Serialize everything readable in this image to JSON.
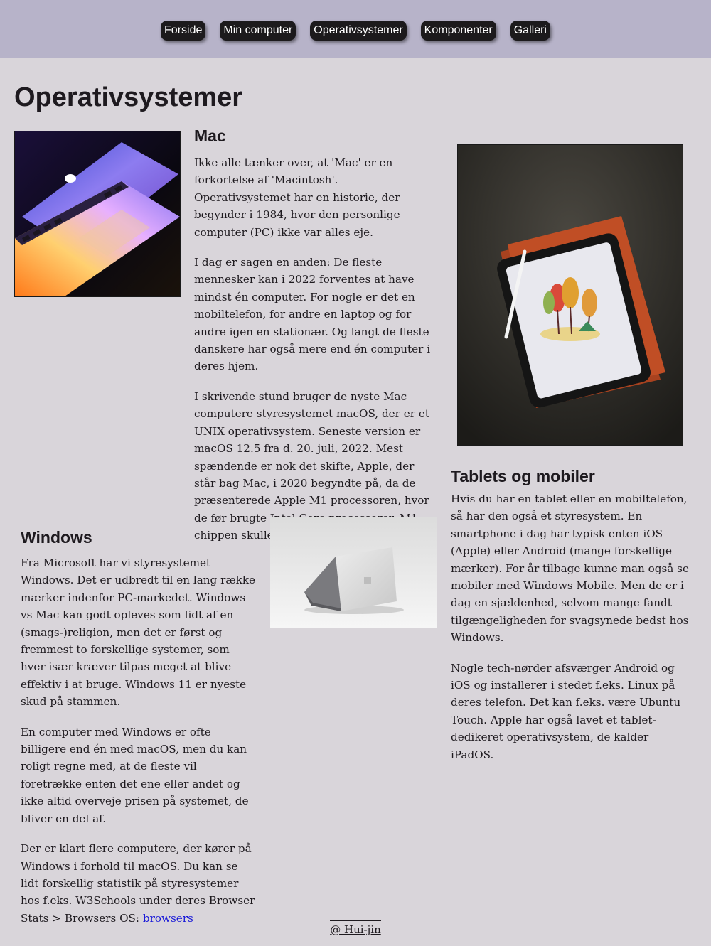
{
  "nav": {
    "items": [
      "Forside",
      "Min computer",
      "Operativsystemer",
      "Komponenter",
      "Galleri"
    ]
  },
  "page_title": "Operativsystemer",
  "mac": {
    "heading": "Mac",
    "paragraphs": [
      "Ikke alle tænker over, at 'Mac' er en forkortelse af 'Macintosh'. Operativsystemet har en historie, der begynder i 1984, hvor den personlige computer (PC) ikke var alles eje.",
      "I dag er sagen en anden: De fleste mennesker kan i 2022 forventes at have mindst én computer. For nogle er det en mobiltelefon, for andre en laptop og for andre igen en stationær. Og langt de fleste danskere har også mere end én computer i deres hjem.",
      "I skrivende stund bruger de nyste Mac computere styresystemet macOS, der er et UNIX operativsystem. Seneste version er macOS 12.5 fra d. 20. juli, 2022. Mest spændende er nok det skifte, Apple, der står bag Mac, i 2020 begyndte på, da de præsenterede Apple M1 processoren, hvor de før brugte Intel Core processorer. M1 chippen skulle være revolutionær."
    ]
  },
  "windows": {
    "heading": "Windows",
    "paragraphs": [
      "Fra Microsoft har vi styresystemet Windows. Det er udbredt til en lang række mærker indenfor PC-markedet. Windows vs Mac kan godt opleves som lidt af en (smags-)religion, men det er først og fremmest to forskellige systemer, som hver især kræver tilpas meget at blive effektiv i at bruge. Windows 11 er nyeste skud på stammen.",
      "En computer med Windows er ofte billigere end én med macOS, men du kan roligt regne med, at de fleste vil foretrække enten det ene eller andet og ikke altid overveje prisen på systemet, de bliver en del af."
    ],
    "last_paragraph": "Der er klart flere computere, der kører på Windows i forhold til macOS. Du kan se lidt forskellig statistik på styresystemer hos f.eks. W3Schools under deres Browser Stats > Browsers OS:",
    "link_text": "browsers"
  },
  "tablets": {
    "heading": "Tablets og mobiler",
    "paragraphs": [
      "Hvis du har en tablet eller en mobiltelefon, så har den også et styresystem. En smartphone i dag har typisk enten iOS (Apple) eller Android (mange forskellige mærker). For år tilbage kunne man også se mobiler med Windows Mobile. Men de er i dag en sjældenhed, selvom mange fandt tilgængeligheden for svagsynede bedst hos Windows.",
      "Nogle tech-nørder afsværger Android og iOS og installerer i stedet f.eks. Linux på deres telefon. Det kan f.eks. være Ubuntu Touch. Apple har også lavet et tablet-dedikeret operativsystem, de kalder iPadOS."
    ]
  },
  "footer": {
    "text": "@ Hui-jin"
  },
  "colors": {
    "header_bg": "#b7b3c9",
    "page_bg": "#d9d5da",
    "nav_button_bg": "#1c1a1c",
    "link": "#1a1ad8"
  },
  "images": {
    "mac_photo": "laptop-rainbow-photo",
    "tablet_photo": "ipad-on-case-photo",
    "windows_photo": "surface-laptop-photo"
  }
}
